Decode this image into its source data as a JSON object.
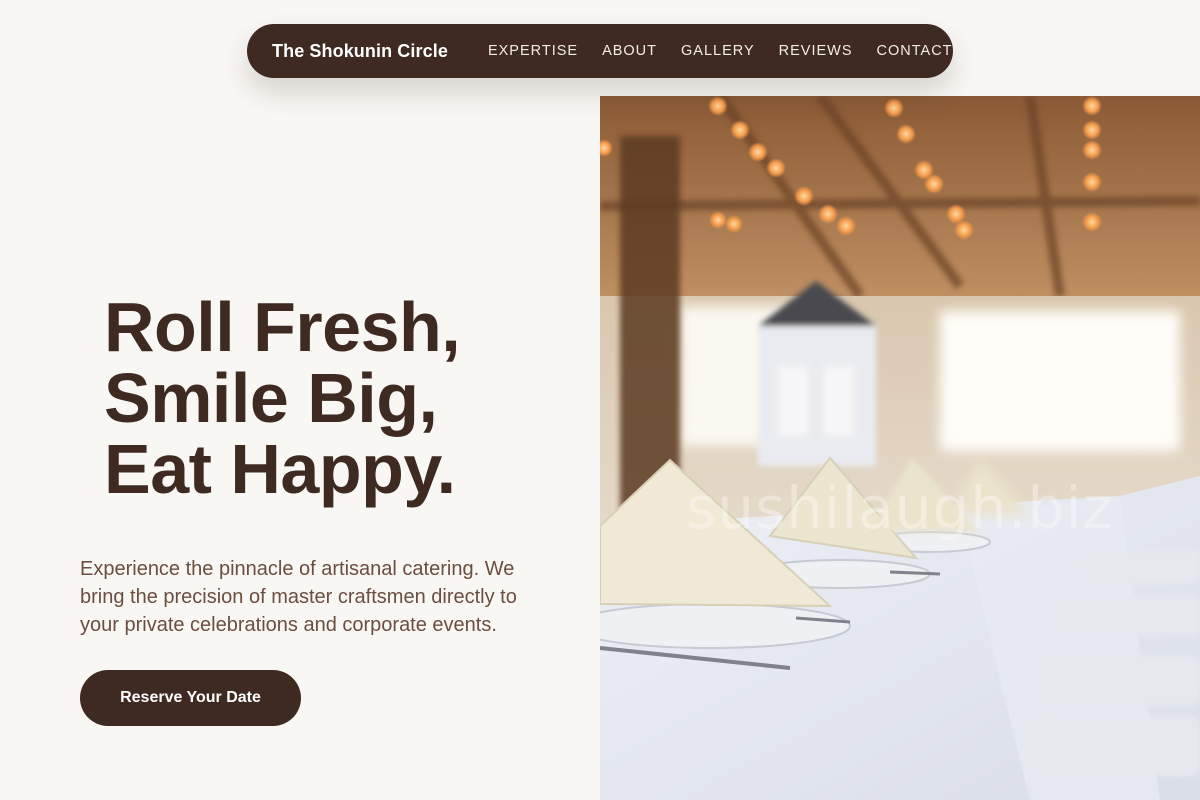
{
  "nav": {
    "brand": "The Shokunin Circle",
    "links": [
      "EXPERTISE",
      "ABOUT",
      "GALLERY",
      "REVIEWS",
      "CONTACT"
    ]
  },
  "hero": {
    "headline": [
      "Roll Fresh,",
      "Smile Big,",
      "Eat Happy."
    ],
    "description": "Experience the pinnacle of artisanal catering. We bring the precision of master craftsmen directly to your private celebrations and corporate events.",
    "cta_label": "Reserve Your Date",
    "image_watermark": "sushilaugh.biz"
  },
  "colors": {
    "background": "#f9f7f4",
    "primary": "#3e2a20",
    "body_text": "#6b4e3f",
    "nav_text": "#f3ece6"
  }
}
